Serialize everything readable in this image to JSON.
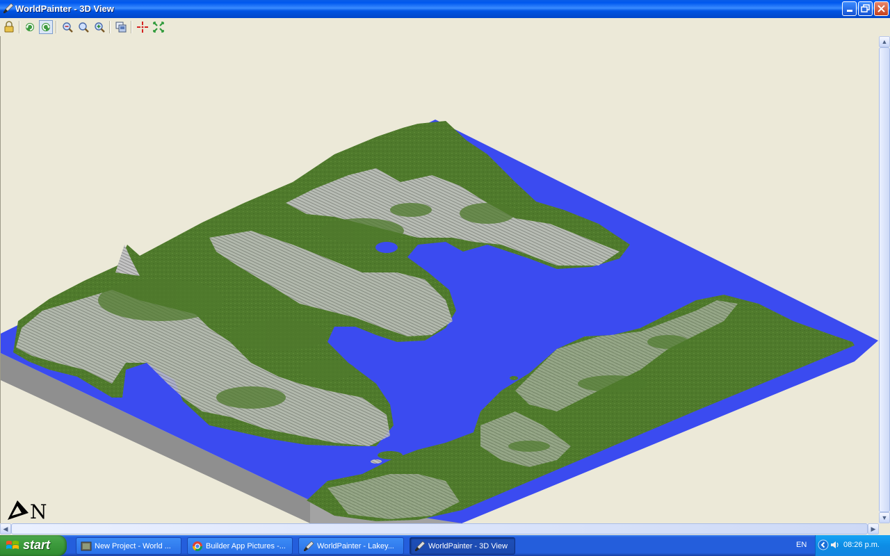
{
  "window": {
    "title": "WorldPainter - 3D View",
    "icon": "worldpainter-brush-icon",
    "controls": [
      "minimize",
      "maximize",
      "close"
    ]
  },
  "toolbar": {
    "buttons": [
      {
        "name": "lock-icon"
      },
      {
        "name": "rotate-left-icon"
      },
      {
        "name": "rotate-right-icon"
      },
      {
        "name": "zoom-out-icon"
      },
      {
        "name": "zoom-reset-icon"
      },
      {
        "name": "zoom-in-icon"
      },
      {
        "name": "export-image-icon"
      },
      {
        "name": "move-to-spawn-icon"
      },
      {
        "name": "move-to-origin-icon"
      }
    ]
  },
  "viewport": {
    "background": "#ECE9D8",
    "compass": {
      "label": "N"
    }
  },
  "taskbar": {
    "start_label": "start",
    "tasks": [
      {
        "label": "New Project - World ...",
        "icon": "image-viewer-icon",
        "active": false
      },
      {
        "label": "Builder App Pictures -...",
        "icon": "chrome-icon",
        "active": false
      },
      {
        "label": "WorldPainter - Lakey...",
        "icon": "worldpainter-brush-icon",
        "active": false
      },
      {
        "label": "WorldPainter - 3D View",
        "icon": "worldpainter-brush-icon",
        "active": true
      }
    ],
    "language": "EN",
    "clock": "08:26 p.m."
  },
  "colors": {
    "water": "#3B4BF0",
    "grass": "#4F7A2C",
    "rock": "#B9B9B9",
    "side": "#9A9A9A",
    "titlebar": "#0054E3",
    "taskbar": "#245EDC",
    "start": "#3C9A3C"
  }
}
